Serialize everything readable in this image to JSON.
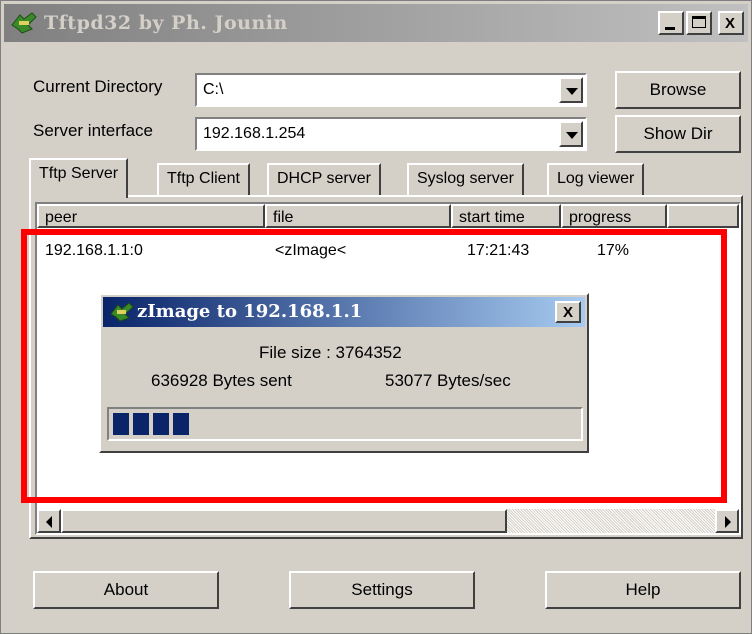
{
  "window": {
    "title": "Tftpd32 by Ph. Jounin",
    "minimize": "_",
    "close": "X"
  },
  "current_directory": {
    "label": "Current Directory",
    "value": "C:\\"
  },
  "server_interface": {
    "label": "Server interface",
    "value": "192.168.1.254"
  },
  "buttons": {
    "browse": "Browse",
    "show_dir": "Show Dir",
    "about": "About",
    "settings": "Settings",
    "help": "Help"
  },
  "tabs": [
    {
      "label": "Tftp Server",
      "active": true
    },
    {
      "label": "Tftp Client",
      "active": false
    },
    {
      "label": "DHCP server",
      "active": false
    },
    {
      "label": "Syslog server",
      "active": false
    },
    {
      "label": "Log viewer",
      "active": false
    }
  ],
  "table": {
    "columns": [
      "peer",
      "file",
      "start time",
      "progress"
    ],
    "rows": [
      {
        "peer": "192.168.1.1:0",
        "file": "<zImage<",
        "start_time": "17:21:43",
        "progress": "17%"
      }
    ]
  },
  "transfer_dialog": {
    "title": "zImage to 192.168.1.1",
    "close": "X",
    "file_size": "File size : 3764352",
    "bytes_sent": "636928 Bytes sent",
    "rate": "53077 Bytes/sec",
    "progress_fraction": 0.17
  },
  "highlight_color": "#ff0000",
  "accent_color": "#0a246a"
}
